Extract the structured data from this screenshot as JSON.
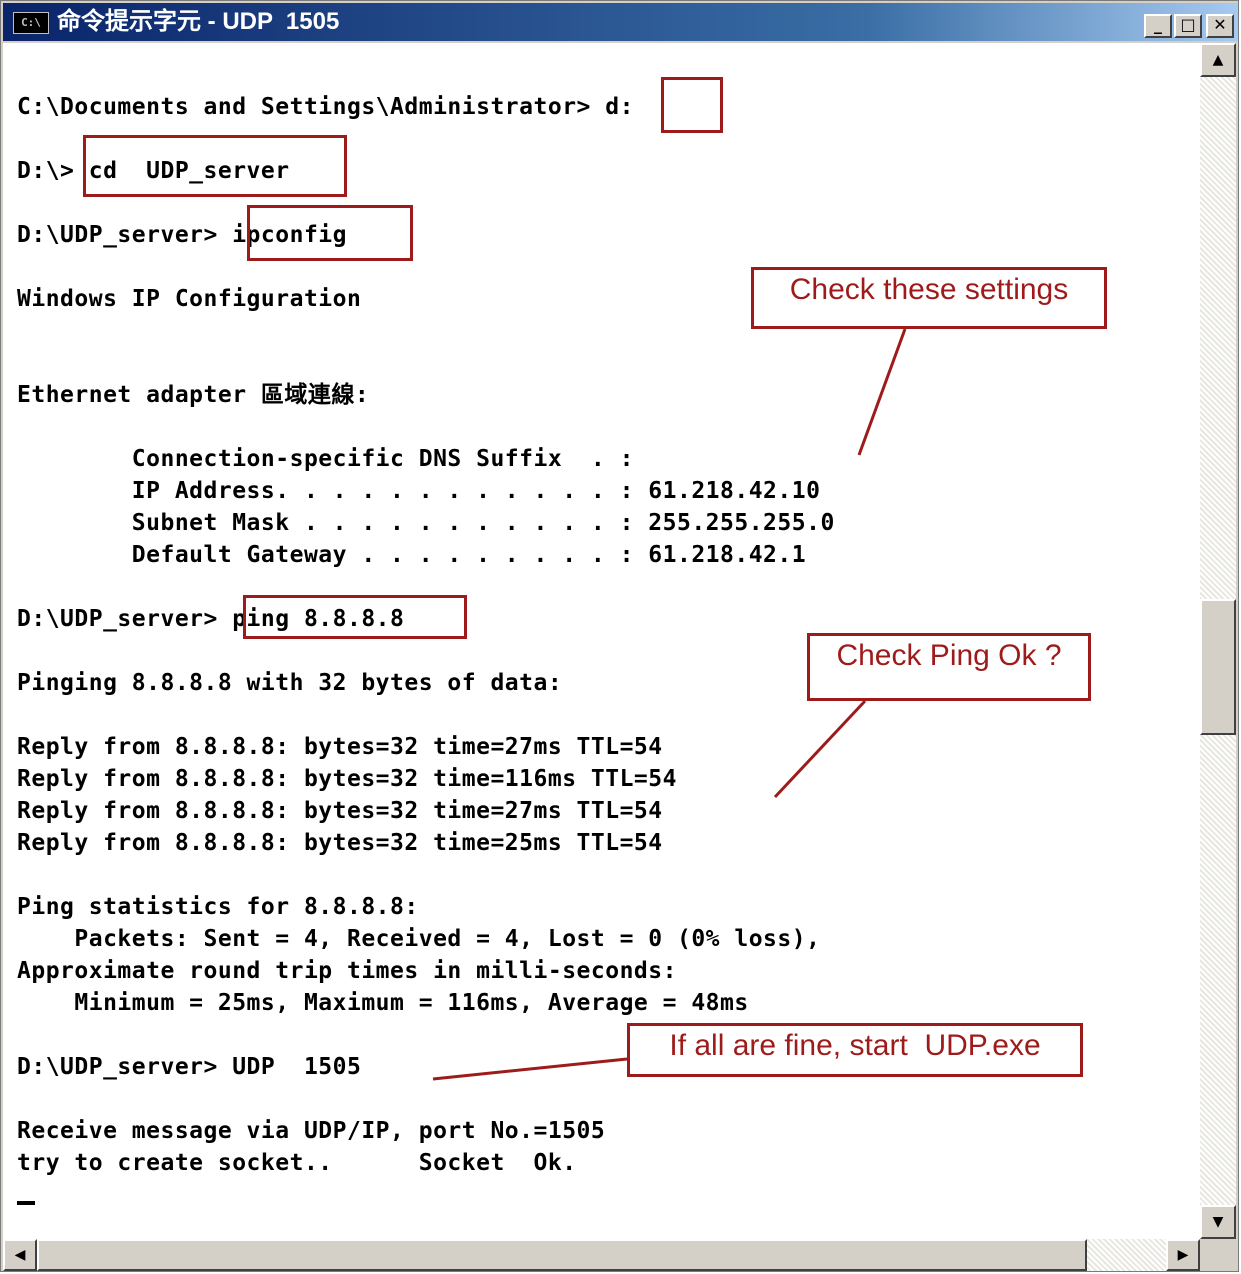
{
  "window": {
    "title": "命令提示字元 - UDP  1505",
    "icon": "cmd-icon",
    "icon_text": "C:\\",
    "buttons": {
      "minimize": "_",
      "maximize": "□",
      "close": "✕"
    }
  },
  "console": {
    "lines": [
      "C:\\Documents and Settings\\Administrator> d:",
      "D:\\> cd  UDP_server",
      "D:\\UDP_server> ipconfig",
      "Windows IP Configuration",
      "",
      "",
      "Ethernet adapter 區域連線:",
      "",
      "        Connection-specific DNS Suffix  . :",
      "        IP Address. . . . . . . . . . . . : 61.218.42.10",
      "        Subnet Mask . . . . . . . . . . . : 255.255.255.0",
      "        Default Gateway . . . . . . . . . : 61.218.42.1",
      "",
      "D:\\UDP_server> ping 8.8.8.8",
      "",
      "Pinging 8.8.8.8 with 32 bytes of data:",
      "",
      "Reply from 8.8.8.8: bytes=32 time=27ms TTL=54",
      "Reply from 8.8.8.8: bytes=32 time=116ms TTL=54",
      "Reply from 8.8.8.8: bytes=32 time=27ms TTL=54",
      "Reply from 8.8.8.8: bytes=32 time=25ms TTL=54",
      "",
      "Ping statistics for 8.8.8.8:",
      "    Packets: Sent = 4, Received = 4, Lost = 0 (0% loss),",
      "Approximate round trip times in milli-seconds:",
      "    Minimum = 25ms, Maximum = 116ms, Average = 48ms",
      "",
      "D:\\UDP_server> UDP  1505",
      "",
      "Receive message via UDP/IP, port No.=1505",
      "try to create socket..      Socket  Ok."
    ]
  },
  "annotations": {
    "check_settings": "Check these settings",
    "check_ping": "Check Ping Ok ?",
    "start_udp": "If all are fine, start  UDP.exe"
  },
  "scrollbar": {
    "up_arrow": "▲",
    "down_arrow": "▼",
    "left_arrow": "◀",
    "right_arrow": "▶"
  },
  "colors": {
    "annotation_red": "#9e1b1b",
    "title_bar_start": "#0a246a",
    "title_bar_end": "#a6caf0"
  }
}
